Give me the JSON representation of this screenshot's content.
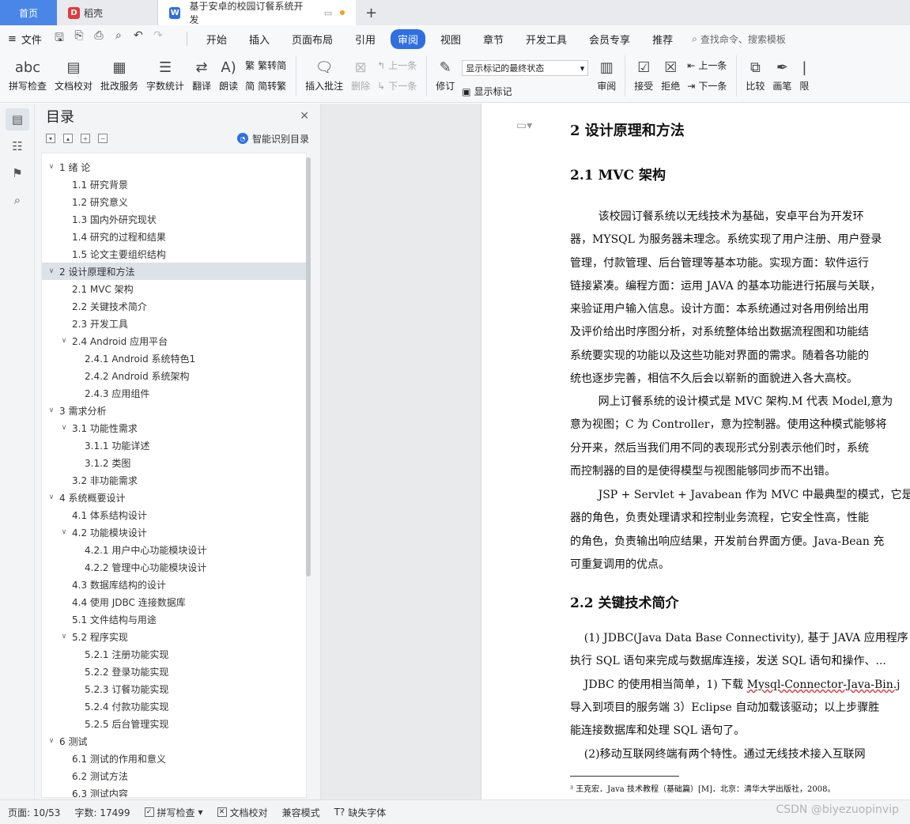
{
  "tabs": {
    "home": "首页",
    "daoke": "稻壳",
    "doc": "基于安卓的校园订餐系统开发"
  },
  "menu": {
    "file": "文件",
    "items": [
      "开始",
      "插入",
      "页面布局",
      "引用",
      "审阅",
      "视图",
      "章节",
      "开发工具",
      "会员专享",
      "推荐"
    ],
    "active": "审阅",
    "search": "查找命令、搜索模板"
  },
  "ribbon": {
    "spell": "拼写检查",
    "proof": "文档校对",
    "batch": "批改服务",
    "count": "字数统计",
    "translate": "翻译",
    "read": "朗读",
    "trad": "繁转简",
    "simp": "简转繁",
    "insert_comment": "插入批注",
    "delete": "删除",
    "prev": "上一条",
    "next": "下一条",
    "revise": "修订",
    "markup_select": "显示标记的最终状态",
    "show_markup": "显示标记",
    "review": "审阅",
    "accept": "接受",
    "reject": "拒绝",
    "prev2": "上一条",
    "next2": "下一条",
    "compare": "比较",
    "pen": "画笔",
    "more": "限"
  },
  "toc": {
    "title": "目录",
    "smart": "智能识别目录",
    "items": [
      {
        "text": "1  绪  论",
        "level": 0,
        "arrow": "∨"
      },
      {
        "text": "1.1  研究背景",
        "level": 1,
        "arrow": ""
      },
      {
        "text": "1.2  研究意义",
        "level": 1,
        "arrow": ""
      },
      {
        "text": "1.3  国内外研究现状",
        "level": 1,
        "arrow": ""
      },
      {
        "text": "1.4  研究的过程和结果",
        "level": 1,
        "arrow": ""
      },
      {
        "text": "1.5  论文主要组织结构",
        "level": 1,
        "arrow": ""
      },
      {
        "text": "2  设计原理和方法",
        "level": 0,
        "arrow": "∨"
      },
      {
        "text": "2.1 MVC 架构",
        "level": 1,
        "arrow": ""
      },
      {
        "text": "2.2  关键技术简介",
        "level": 1,
        "arrow": ""
      },
      {
        "text": "2.3  开发工具",
        "level": 1,
        "arrow": ""
      },
      {
        "text": "2.4 Android 应用平台",
        "level": 1,
        "arrow": "∨"
      },
      {
        "text": "2.4.1 Android 系统特色1",
        "level": 2,
        "arrow": ""
      },
      {
        "text": "2.4.2 Android 系统架构",
        "level": 2,
        "arrow": ""
      },
      {
        "text": "2.4.3  应用组件",
        "level": 2,
        "arrow": ""
      },
      {
        "text": "3  需求分析",
        "level": 0,
        "arrow": "∨"
      },
      {
        "text": "3.1  功能性需求",
        "level": 1,
        "arrow": "∨"
      },
      {
        "text": "3.1.1  功能详述",
        "level": 2,
        "arrow": ""
      },
      {
        "text": "3.1.2  类图",
        "level": 2,
        "arrow": ""
      },
      {
        "text": "3.2  非功能需求",
        "level": 1,
        "arrow": ""
      },
      {
        "text": "4  系统概要设计",
        "level": 0,
        "arrow": "∨"
      },
      {
        "text": "4.1  体系结构设计",
        "level": 1,
        "arrow": ""
      },
      {
        "text": "4.2  功能模块设计",
        "level": 1,
        "arrow": "∨"
      },
      {
        "text": "4.2.1  用户中心功能模块设计",
        "level": 2,
        "arrow": ""
      },
      {
        "text": "4.2.2  管理中心功能模块设计",
        "level": 2,
        "arrow": ""
      },
      {
        "text": "4.3  数据库结构的设计",
        "level": 1,
        "arrow": ""
      },
      {
        "text": "4.4  使用 JDBC 连接数据库",
        "level": 1,
        "arrow": ""
      },
      {
        "text": "5.1 文件结构与用途",
        "level": 1,
        "arrow": ""
      },
      {
        "text": "5.2  程序实现",
        "level": 1,
        "arrow": "∨"
      },
      {
        "text": "5.2.1  注册功能实现",
        "level": 2,
        "arrow": ""
      },
      {
        "text": "5.2.2  登录功能实现",
        "level": 2,
        "arrow": ""
      },
      {
        "text": "5.2.3  订餐功能实现",
        "level": 2,
        "arrow": ""
      },
      {
        "text": "5.2.4  付款功能实现",
        "level": 2,
        "arrow": ""
      },
      {
        "text": "5.2.5  后台管理实现",
        "level": 2,
        "arrow": ""
      },
      {
        "text": "6  测试",
        "level": 0,
        "arrow": "∨"
      },
      {
        "text": "6.1  测试的作用和意义",
        "level": 1,
        "arrow": ""
      },
      {
        "text": "6.2  测试方法",
        "level": 1,
        "arrow": ""
      },
      {
        "text": "6.3  测试内容",
        "level": 1,
        "arrow": ""
      }
    ],
    "selected_index": 6
  },
  "doc": {
    "h1": "2  设计原理和方法",
    "h2a": "2.1 MVC 架构",
    "para1": [
      "        该校园订餐系统以无线技术为基础，安卓平台为开发环",
      "器，MYSQL 为服务器未理念。系统实现了用户注册、用户登录",
      "管理，付款管理、后台管理等基本功能。实现方面：软件运行",
      "链接紧凑。编程方面：运用 JAVA 的基本功能进行拓展与关联，",
      "来验证用户输入信息。设计方面：本系统通过对各用例给出用",
      "及评价给出时序图分析，对系统整体给出数据流程图和功能结",
      "系统要实现的功能以及这些功能对界面的需求。随着各功能的",
      "统也逐步完善，相信不久后会以崭新的面貌进入各大高校。"
    ],
    "para2": [
      "        网上订餐系统的设计模式是 MVC 架构.M 代表 Model,意为",
      "意为视图；C 为 Controller，意为控制器。使用这种模式能够将",
      "分开来，然后当我们用不同的表现形式分别表示他们时，系统",
      "而控制器的目的是使得模型与视图能够同步而不出错。"
    ],
    "para3": [
      "        JSP + Servlet + Javabean 作为 MVC 中最典型的模式，它是",
      "器的角色，负责处理请求和控制业务流程，它安全性高，性能",
      "的角色，负责输出响应结果，开发前台界面方便。Java-Bean 充",
      "可重复调用的优点。"
    ],
    "h2b": "2.2 关键技术简介",
    "para4": [
      "    (1) JDBC(Java Data Base Connectivity), 基于 JAVA 应用程序",
      "执行 SQL 语句来完成与数据库连接，发送 SQL 语句和操作、..."
    ],
    "para5_pre": "    JDBC 的使用相当简单，1) 下载 ",
    "para5_link": "Mysql-Connector-Java-Bin.j",
    "para5_rest": [
      "导入到项目的服务端 3）Eclipse 自动加载该驱动；以上步骤胜",
      "能连接数据库和处理 SQL 语句了。"
    ],
    "para6": "    (2)移动互联网终端有两个特性。通过无线技术接入互联网",
    "footnote": "³ 王克宏．Java 技术教程（基础篇）[M]．北京：清华大学出版社，2008。"
  },
  "status": {
    "page": "页面: 10/53",
    "words": "字数: 17499",
    "spell": "拼写检查",
    "proof": "文档校对",
    "compat": "兼容模式",
    "font": "缺失字体"
  },
  "watermark": "CSDN @biyezuopinvip"
}
